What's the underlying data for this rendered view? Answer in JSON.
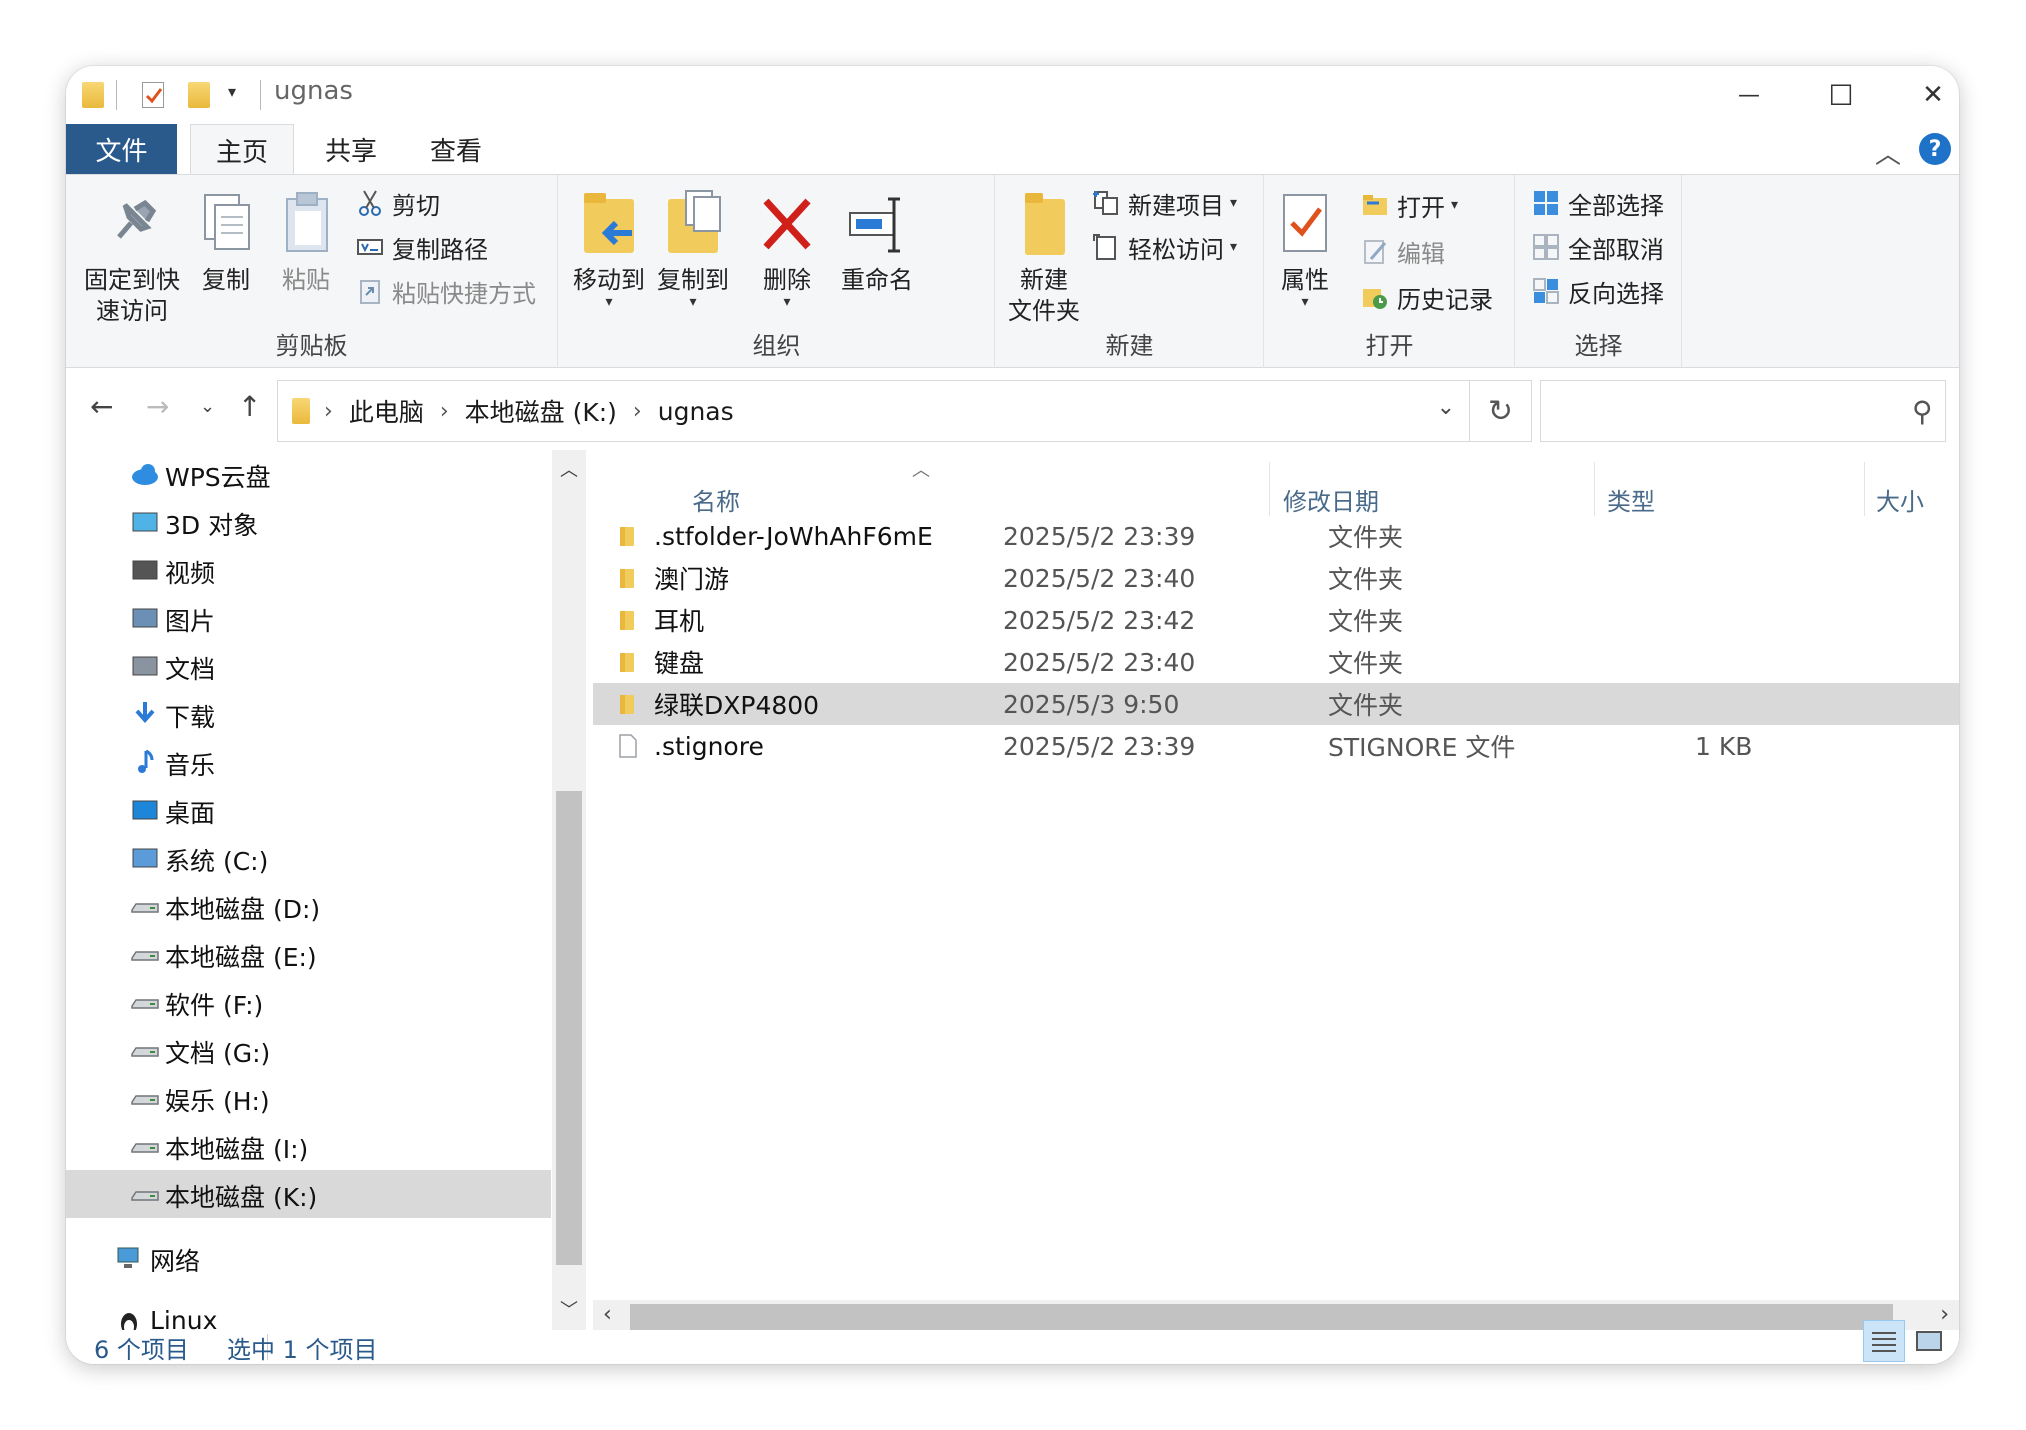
{
  "window": {
    "title": "ugnas",
    "controls": {
      "minimize": "—",
      "maximize": "☐",
      "close": "✕"
    }
  },
  "tabs": {
    "file": "文件",
    "home": "主页",
    "share": "共享",
    "view": "查看",
    "help": "?"
  },
  "ribbon": {
    "clipboard": {
      "label": "剪贴板",
      "pin_line1": "固定到快",
      "pin_line2": "速访问",
      "copy": "复制",
      "paste": "粘贴",
      "cut": "剪切",
      "copy_path": "复制路径",
      "paste_shortcut": "粘贴快捷方式"
    },
    "organize": {
      "label": "组织",
      "move_to": "移动到",
      "copy_to": "复制到",
      "delete": "删除",
      "rename": "重命名"
    },
    "new": {
      "label": "新建",
      "new_folder_line1": "新建",
      "new_folder_line2": "文件夹",
      "new_item": "新建项目",
      "easy_access": "轻松访问"
    },
    "open": {
      "label": "打开",
      "properties": "属性",
      "open": "打开",
      "edit": "编辑",
      "history": "历史记录"
    },
    "select": {
      "label": "选择",
      "select_all": "全部选择",
      "select_none": "全部取消",
      "invert": "反向选择"
    }
  },
  "address": {
    "crumbs": [
      "此电脑",
      "本地磁盘 (K:)",
      "ugnas"
    ],
    "search_placeholder": ""
  },
  "nav": {
    "items": [
      {
        "label": "WPS云盘",
        "icon": "cloud-icon"
      },
      {
        "label": "3D 对象",
        "icon": "3d-objects-icon"
      },
      {
        "label": "视频",
        "icon": "video-icon"
      },
      {
        "label": "图片",
        "icon": "pictures-icon"
      },
      {
        "label": "文档",
        "icon": "documents-icon"
      },
      {
        "label": "下载",
        "icon": "download-icon"
      },
      {
        "label": "音乐",
        "icon": "music-icon"
      },
      {
        "label": "桌面",
        "icon": "desktop-icon"
      },
      {
        "label": "系统 (C:)",
        "icon": "system-drive-icon"
      },
      {
        "label": "本地磁盘 (D:)",
        "icon": "drive-icon"
      },
      {
        "label": "本地磁盘 (E:)",
        "icon": "drive-icon"
      },
      {
        "label": "软件 (F:)",
        "icon": "drive-icon"
      },
      {
        "label": "文档 (G:)",
        "icon": "drive-icon"
      },
      {
        "label": "娱乐 (H:)",
        "icon": "drive-icon"
      },
      {
        "label": "本地磁盘 (I:)",
        "icon": "drive-icon"
      },
      {
        "label": "本地磁盘 (K:)",
        "icon": "drive-icon",
        "selected": true
      }
    ],
    "network": "网络",
    "linux": "Linux"
  },
  "columns": {
    "name": "名称",
    "date": "修改日期",
    "type": "类型",
    "size": "大小"
  },
  "files": [
    {
      "name": ".stfolder-JoWhAhF6mE",
      "date": "2025/5/2 23:39",
      "type": "文件夹",
      "size": "",
      "kind": "folder"
    },
    {
      "name": "澳门游",
      "date": "2025/5/2 23:40",
      "type": "文件夹",
      "size": "",
      "kind": "folder"
    },
    {
      "name": "耳机",
      "date": "2025/5/2 23:42",
      "type": "文件夹",
      "size": "",
      "kind": "folder"
    },
    {
      "name": "键盘",
      "date": "2025/5/2 23:40",
      "type": "文件夹",
      "size": "",
      "kind": "folder"
    },
    {
      "name": "绿联DXP4800",
      "date": "2025/5/3 9:50",
      "type": "文件夹",
      "size": "",
      "kind": "folder",
      "selected": true
    },
    {
      "name": ".stignore",
      "date": "2025/5/2 23:39",
      "type": "STIGNORE 文件",
      "size": "1 KB",
      "kind": "file"
    }
  ],
  "status": {
    "count": "6 个项目",
    "selected": "选中 1 个项目"
  },
  "colors": {
    "accent": "#2a5a8c",
    "folder": "#eab93c",
    "selection": "#d9d9d9",
    "help": "#1e73c9",
    "delete": "#d0201a"
  }
}
